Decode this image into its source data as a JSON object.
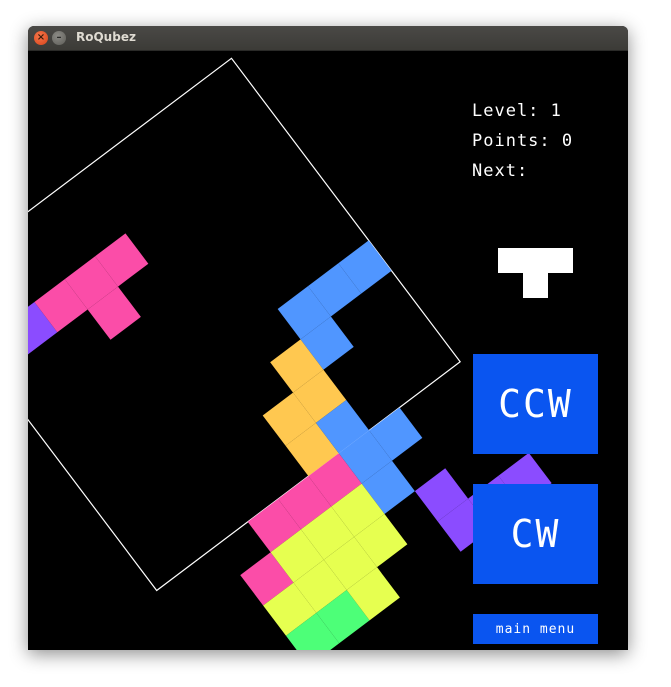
{
  "window": {
    "title": "RoQubez"
  },
  "titlebar_buttons": {
    "close_glyph": "×",
    "minimize_glyph": "–"
  },
  "hud": {
    "level_text": "Level: 1",
    "points_text": "Points: 0",
    "next_text": "Next:"
  },
  "controls": {
    "ccw_label": "CCW",
    "cw_label": "CW",
    "menu_label": "main menu"
  },
  "colors": {
    "background": "#000000",
    "button": "#0a55f0",
    "frame": "#ffffff",
    "next_piece": "#ffffff",
    "purple": "#8b4cff",
    "pink": "#fb4da8",
    "blue": "#5096ff",
    "orange": "#ffc850",
    "yellow": "#e6ff50",
    "green": "#4dff78"
  },
  "game": {
    "rotation_deg": -37,
    "next_piece": "T",
    "board_cells": [
      {
        "c": 0,
        "r": 2,
        "color": "purple"
      },
      {
        "c": 1,
        "r": 2,
        "color": "purple"
      },
      {
        "c": 2,
        "r": 2,
        "color": "pink"
      },
      {
        "c": 3,
        "r": 2,
        "color": "pink"
      },
      {
        "c": 4,
        "r": 2,
        "color": "pink"
      },
      {
        "c": 3,
        "r": 3,
        "color": "pink"
      },
      {
        "c": 7,
        "r": 6,
        "color": "blue"
      },
      {
        "c": 8,
        "r": 6,
        "color": "blue"
      },
      {
        "c": 9,
        "r": 6,
        "color": "blue"
      },
      {
        "c": 7,
        "r": 7,
        "color": "blue"
      },
      {
        "c": 6,
        "r": 7,
        "color": "orange"
      },
      {
        "c": 6,
        "r": 8,
        "color": "orange"
      },
      {
        "c": 5,
        "r": 8,
        "color": "orange"
      },
      {
        "c": 5,
        "r": 9,
        "color": "orange"
      },
      {
        "c": 6,
        "r": 9,
        "color": "blue"
      },
      {
        "c": 6,
        "r": 10,
        "color": "blue"
      },
      {
        "c": 7,
        "r": 10,
        "color": "blue"
      },
      {
        "c": 6,
        "r": 11,
        "color": "blue"
      },
      {
        "c": 3,
        "r": 10,
        "color": "pink"
      },
      {
        "c": 4,
        "r": 10,
        "color": "pink"
      },
      {
        "c": 5,
        "r": 10,
        "color": "pink"
      },
      {
        "c": 2,
        "r": 11,
        "color": "pink"
      },
      {
        "c": 3,
        "r": 11,
        "color": "yellow"
      },
      {
        "c": 4,
        "r": 11,
        "color": "yellow"
      },
      {
        "c": 5,
        "r": 11,
        "color": "yellow"
      },
      {
        "c": 2,
        "r": 12,
        "color": "yellow"
      },
      {
        "c": 3,
        "r": 12,
        "color": "yellow"
      },
      {
        "c": 4,
        "r": 12,
        "color": "yellow"
      },
      {
        "c": 5,
        "r": 12,
        "color": "yellow"
      },
      {
        "c": 2,
        "r": 13,
        "color": "green"
      },
      {
        "c": 3,
        "r": 13,
        "color": "green"
      },
      {
        "c": 4,
        "r": 13,
        "color": "yellow"
      },
      {
        "c": 7,
        "r": 12,
        "color": "purple"
      },
      {
        "c": 7,
        "r": 13,
        "color": "purple"
      },
      {
        "c": 8,
        "r": 13,
        "color": "purple"
      },
      {
        "c": 9,
        "r": 13,
        "color": "purple"
      }
    ]
  }
}
